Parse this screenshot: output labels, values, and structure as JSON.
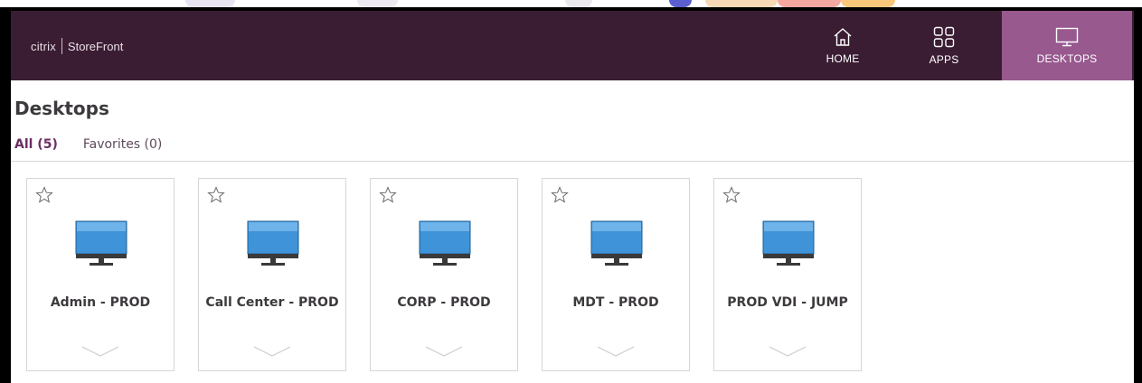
{
  "brand": {
    "company": "citrix",
    "product": "StoreFront"
  },
  "nav": {
    "items": [
      {
        "label": "HOME",
        "icon": "home-icon",
        "active": false
      },
      {
        "label": "APPS",
        "icon": "apps-grid-icon",
        "active": false
      },
      {
        "label": "DESKTOPS",
        "icon": "desktop-monitor-icon",
        "active": true
      }
    ]
  },
  "page": {
    "title": "Desktops",
    "filters": [
      {
        "label": "All (5)",
        "active": true
      },
      {
        "label": "Favorites (0)",
        "active": false
      }
    ]
  },
  "desktops": [
    {
      "name": "Admin - PROD",
      "favorite": false
    },
    {
      "name": "Call Center - PROD",
      "favorite": false
    },
    {
      "name": "CORP - PROD",
      "favorite": false
    },
    {
      "name": "MDT - PROD",
      "favorite": false
    },
    {
      "name": "PROD VDI - JUMP",
      "favorite": false
    }
  ],
  "colors": {
    "header_bg": "#3b1d33",
    "active_nav_bg": "#98598f",
    "accent_text": "#6b2f62",
    "monitor_screen": "#3f93d8"
  }
}
